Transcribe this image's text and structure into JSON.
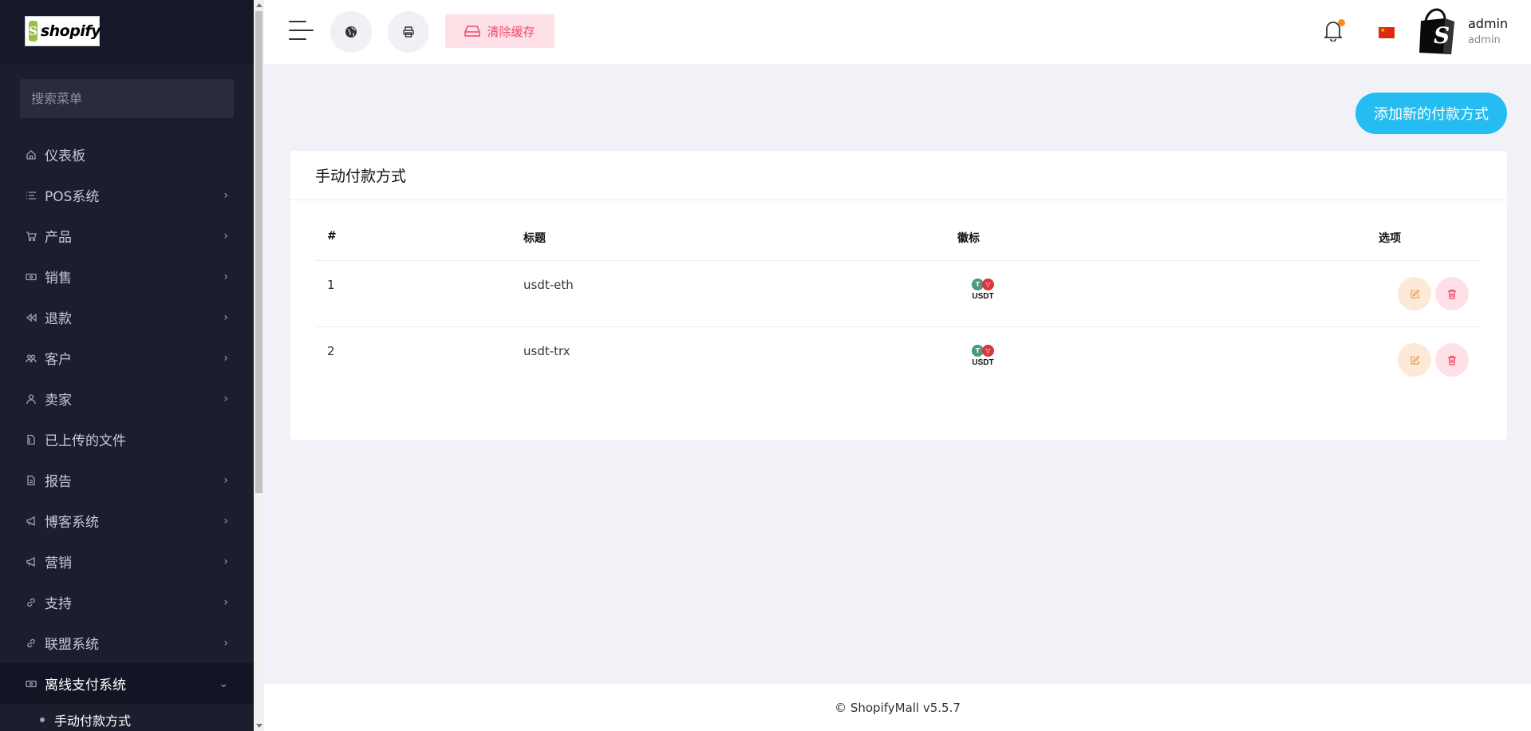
{
  "sidebar": {
    "logo_text": "shopify",
    "logo_bag_letter": "S",
    "search_placeholder": "搜索菜单",
    "items": [
      {
        "label": "仪表板",
        "has_chevron": false
      },
      {
        "label": "POS系统",
        "has_chevron": true
      },
      {
        "label": "产品",
        "has_chevron": true
      },
      {
        "label": "销售",
        "has_chevron": true
      },
      {
        "label": "退款",
        "has_chevron": true
      },
      {
        "label": "客户",
        "has_chevron": true
      },
      {
        "label": "卖家",
        "has_chevron": true
      },
      {
        "label": "已上传的文件",
        "has_chevron": false
      },
      {
        "label": "报告",
        "has_chevron": true
      },
      {
        "label": "博客系统",
        "has_chevron": true
      },
      {
        "label": "营销",
        "has_chevron": true
      },
      {
        "label": "支持",
        "has_chevron": true
      },
      {
        "label": "联盟系统",
        "has_chevron": true
      },
      {
        "label": "离线支付系统",
        "has_chevron": true,
        "expanded": true
      }
    ],
    "subitems": [
      {
        "label": "手动付款方式"
      }
    ]
  },
  "header": {
    "clear_cache_label": "清除缓存",
    "user_name": "admin",
    "user_role": "admin",
    "notification_dot_color": "#f68b1f"
  },
  "main": {
    "add_button_label": "添加新的付款方式",
    "card_title": "手动付款方式",
    "table": {
      "columns": [
        "#",
        "标题",
        "徽标",
        "选项"
      ],
      "rows": [
        {
          "num": "1",
          "title": "usdt-eth",
          "logo_label": "USDT"
        },
        {
          "num": "2",
          "title": "usdt-trx",
          "logo_label": "USDT"
        }
      ]
    }
  },
  "footer": {
    "text": "© ShopifyMall v5.5.7"
  },
  "colors": {
    "sidebar_bg": "#1c1d2d",
    "accent_blue": "#25bcf1",
    "danger_pink": "#ef486a",
    "warning_orange": "#f6a04b"
  }
}
